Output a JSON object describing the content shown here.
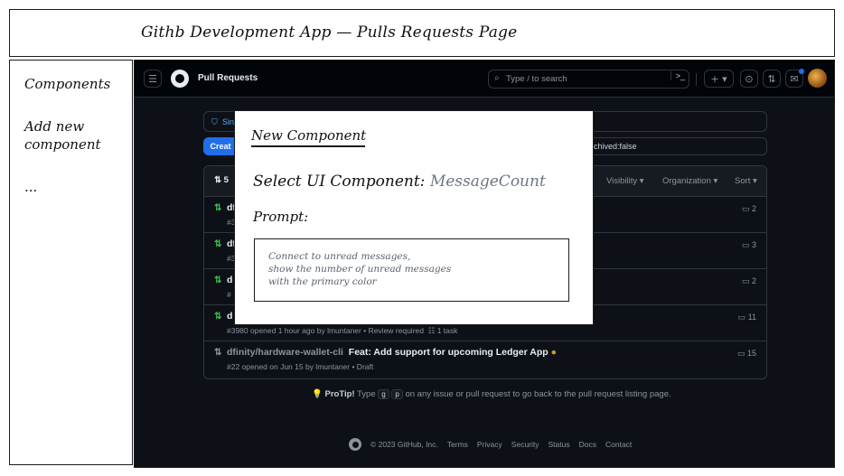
{
  "wireframe": {
    "title": "Githb Development App — Pulls Requests Page",
    "sidebar": {
      "items": [
        {
          "label": "Components"
        },
        {
          "label": "Add new\ncomponent"
        },
        {
          "label": "..."
        }
      ]
    }
  },
  "github": {
    "header": {
      "page_title": "Pull Requests",
      "search_placeholder": "Type / to search",
      "search_key": "/",
      "plus_label": "+ ▾",
      "terminal_label": ">_",
      "menu_icon": "hamburger-icon",
      "logo_icon": "github-logo-icon"
    },
    "filter_chip": "Sing",
    "filter_query_tail": "rchived:false",
    "create_button": "Creat",
    "list": {
      "count_prefix": "5",
      "headers": [
        "Visibility ▾",
        "Organization ▾",
        "Sort ▾"
      ],
      "rows": [
        {
          "title_partial": "df",
          "meta": "#3",
          "comments": "2"
        },
        {
          "title_partial": "df",
          "meta": "#3",
          "comments": "3"
        },
        {
          "title_partial": "d",
          "meta": "#",
          "comments": "2"
        },
        {
          "title_partial": "d",
          "meta": "#3980 opened 1 hour ago by lmuntaner • Review required",
          "task": "1 task",
          "comments": "11"
        },
        {
          "repo": "dfinity/hardware-wallet-cli",
          "title": "Feat: Add support for upcoming Ledger App",
          "meta": "#22 opened on Jun 15 by lmuntaner • Draft",
          "comments": "15"
        }
      ]
    },
    "protip": {
      "label": "ProTip!",
      "text_before": "Type",
      "key1": "g",
      "key2": "p",
      "text_after": "on any issue or pull request to go back to the pull request listing page."
    },
    "footer": {
      "copyright": "© 2023 GitHub, Inc.",
      "links": [
        "Terms",
        "Privacy",
        "Security",
        "Status",
        "Docs",
        "Contact"
      ]
    }
  },
  "modal": {
    "title": "New Component",
    "select_label": "Select UI Component:",
    "select_value": "MessageCount",
    "prompt_label": "Prompt:",
    "prompt_text": "Connect to unread messages,\nshow the number of unread messages\nwith the primary color"
  },
  "colors": {
    "github_bg": "#0d1117",
    "accent_blue": "#1f6feb",
    "open_green": "#3fb950",
    "draft_dot": "#d29922"
  }
}
